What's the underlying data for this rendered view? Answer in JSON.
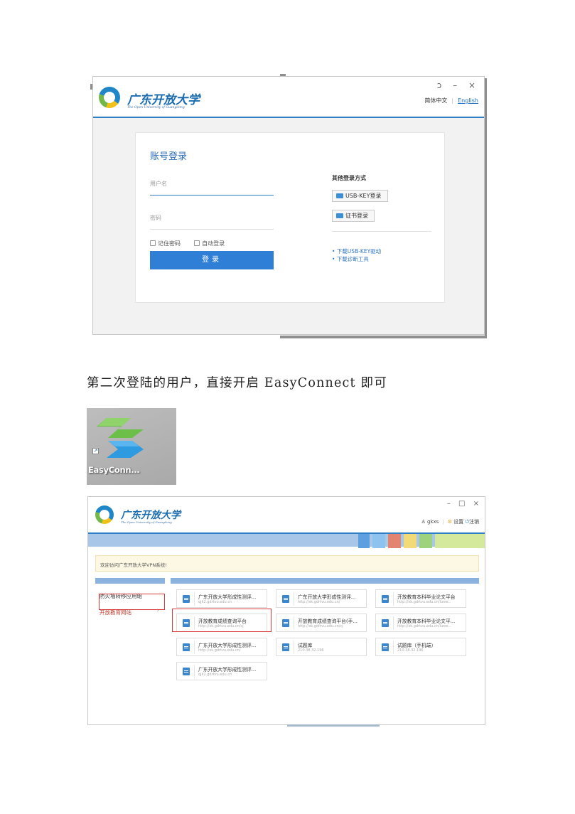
{
  "login_window": {
    "logo_cn": "广东开放大学",
    "logo_en": "The Open University of Guangdong",
    "window_controls": "ɔ – ×",
    "lang_cn": "简体中文",
    "lang_en": "English",
    "title": "账号登录",
    "username_placeholder": "用户名",
    "password_placeholder": "密码",
    "remember_label": "记住密码",
    "auto_login_label": "自动登录",
    "login_button": "登录",
    "other_methods_title": "其他登录方式",
    "usb_key_button": "USB-KEY登录",
    "cert_button": "证书登录",
    "links": [
      "下载USB-KEY驱动",
      "下载诊断工具"
    ]
  },
  "body_text": "第二次登陆的用户，直接开启 EasyConnect 即可",
  "desktop_icon": {
    "label": "EasyConn..."
  },
  "portal_window": {
    "logo_cn": "广东开放大学",
    "logo_en": "The Open University of Guangdong",
    "window_controls": "– □ ×",
    "username": "gkxs",
    "settings": "设置",
    "logout": "注销",
    "welcome": "欢迎访问广东开放大学VPN系统!",
    "groups": [
      "防火墙转移应用组",
      "开放教育网站"
    ],
    "tiles": [
      {
        "title": "广东开放大学形成性测评...",
        "url": "qjk2.gdrtvu.edu.cn"
      },
      {
        "title": "广东开放大学形成性测评...",
        "url": "http://xk.gdrtvu.edu.cn/"
      },
      {
        "title": "开放教育本科毕业论文平台",
        "url": "http://xk.gdrtvu.edu.cn/lunw..."
      },
      {
        "title": "开放教育成绩查询平台",
        "url": "http://xk.gdrtvu.edu.cn/cj"
      },
      {
        "title": "开放教育成绩查询平台(手...",
        "url": "http://xk.gdrtvu.edu.cn/cj"
      },
      {
        "title": "开放教育本科毕业论文平...",
        "url": "http://xk.gdrtvu.edu.cn/lunw..."
      },
      {
        "title": "广东开放大学形成性测评...",
        "url": "http://xk.gdrtvu.edu.cn/"
      },
      {
        "title": "试题库",
        "url": "210.38.32.196"
      },
      {
        "title": "试题库（手机端）",
        "url": "210.38.32.196"
      },
      {
        "title": "广东开放大学形成性测评...",
        "url": "qjk2.gdrtvu.edu.cn"
      }
    ]
  },
  "colors": {
    "brand_blue": "#2f7fc7",
    "button_blue": "#2f7fd6",
    "highlight_red": "#d63a3a"
  }
}
